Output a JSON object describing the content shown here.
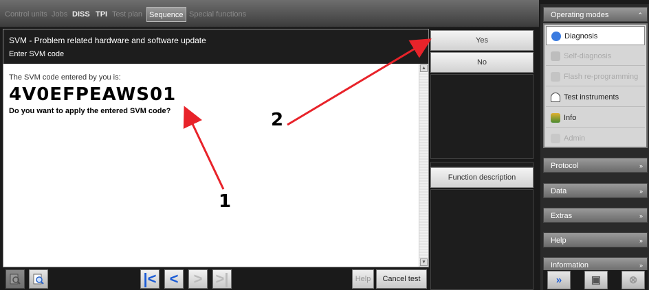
{
  "tabs": [
    {
      "label": "Control units"
    },
    {
      "label": "Jobs"
    },
    {
      "label": "DISS"
    },
    {
      "label": "TPI"
    },
    {
      "label": "Test plan"
    },
    {
      "label": "Sequence"
    },
    {
      "label": "Special functions"
    }
  ],
  "header": {
    "title": "SVM - Problem related hardware and software update",
    "subtitle": "Enter SVM code"
  },
  "content": {
    "intro": "The SVM code entered by you is:",
    "code": "4V0EFPEAWS01",
    "question": "Do you want to apply the entered SVM code?"
  },
  "answers": {
    "yes": "Yes",
    "no": "No",
    "function_description": "Function description"
  },
  "bottom": {
    "help": "Help",
    "cancel": "Cancel test"
  },
  "sidebar": {
    "operating_modes": "Operating modes",
    "modes": [
      {
        "label": "Diagnosis",
        "icon": "diagnosis-icon"
      },
      {
        "label": "Self-diagnosis",
        "icon": "car-icon"
      },
      {
        "label": "Flash re-programming",
        "icon": "flash-icon"
      },
      {
        "label": "Test instruments",
        "icon": "meter-icon"
      },
      {
        "label": "Info",
        "icon": "books-icon"
      },
      {
        "label": "Admin",
        "icon": "admin-icon"
      }
    ],
    "sections": [
      "Protocol",
      "Data",
      "Extras",
      "Help",
      "Information"
    ]
  },
  "annotations": {
    "label_1": "1",
    "label_2": "2"
  },
  "colors": {
    "annotation_arrow": "#e8232a",
    "nav_arrow": "#1a5bd6"
  }
}
